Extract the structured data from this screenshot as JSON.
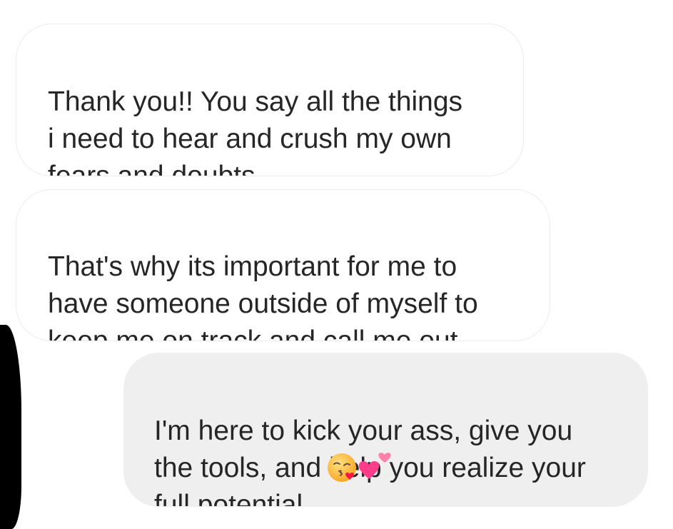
{
  "messages": [
    {
      "direction": "received",
      "text": "Thank you!! You say all the things\ni need to hear and crush my own\nfears and doubts"
    },
    {
      "direction": "received",
      "text": "That's why its important for me to\nhave someone outside of myself to\nkeep me on track and call me out"
    },
    {
      "direction": "sent",
      "text": "I'm here to kick your ass, give you\nthe tools, and help you realize your\nfull potential",
      "emojis": [
        "face-blowing-a-kiss-icon",
        "two-hearts-icon"
      ]
    }
  ],
  "colors": {
    "background": "#ffffff",
    "received_bubble": "#ffffff",
    "received_border": "#ececec",
    "sent_bubble": "#efefef",
    "text": "#262626",
    "redaction": "#000000",
    "emoji_face": "#fbc02d",
    "emoji_heart": "#ff3d8b"
  }
}
